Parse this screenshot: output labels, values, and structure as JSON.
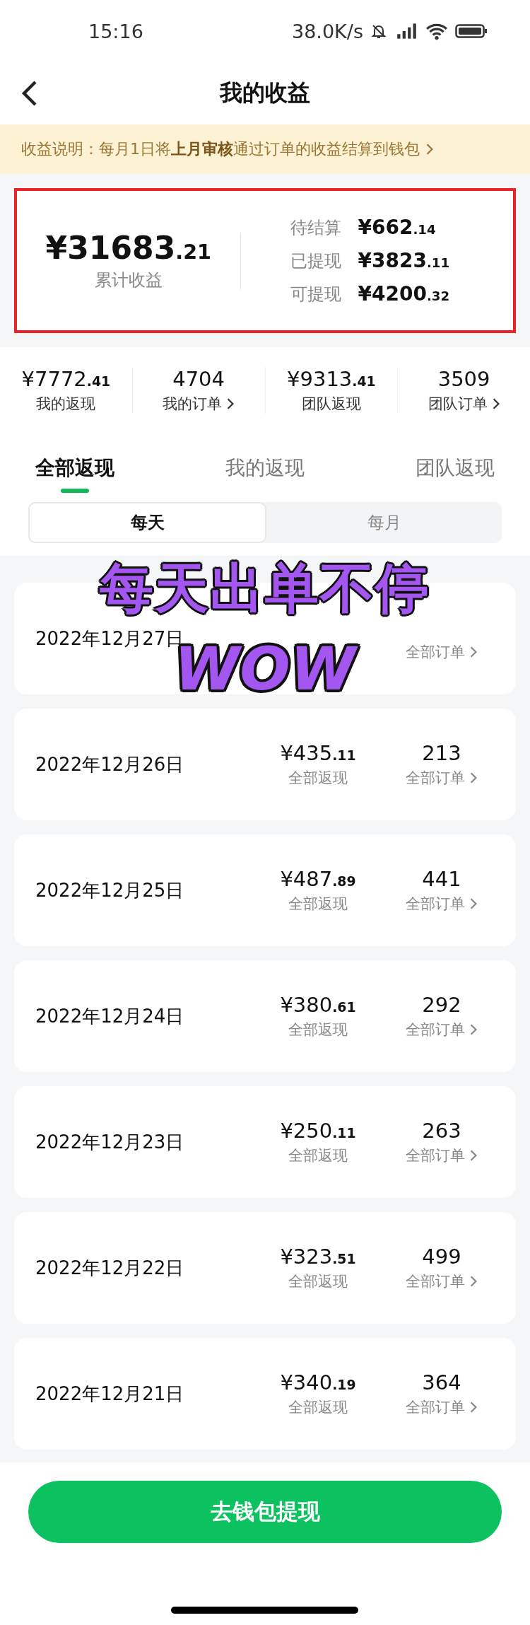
{
  "status_bar": {
    "time": "15:16",
    "speed": "38.0K/s"
  },
  "header": {
    "title": "我的收益"
  },
  "notice": {
    "text": "收益说明：每月1日将**上月审核**通过订单的收益结算到钱包"
  },
  "summary": {
    "total_int": "¥31683",
    "total_dec": ".21",
    "total_label": "累计收益",
    "items": [
      {
        "label": "待结算",
        "int": "¥662",
        "dec": ".14"
      },
      {
        "label": "已提现",
        "int": "¥3823",
        "dec": ".11"
      },
      {
        "label": "可提现",
        "int": "¥4200",
        "dec": ".32"
      }
    ]
  },
  "stats": [
    {
      "int": "¥7772",
      "dec": ".41",
      "label": "我的返现",
      "link": false
    },
    {
      "int": "4704",
      "label": "我的订单",
      "link": true
    },
    {
      "int": "¥9313",
      "dec": ".41",
      "label": "团队返现",
      "link": false
    },
    {
      "int": "3509",
      "label": "团队订单",
      "link": true
    }
  ],
  "tabs": [
    {
      "label": "全部返现",
      "selected": true
    },
    {
      "label": "我的返现",
      "selected": false
    },
    {
      "label": "团队返现",
      "selected": false
    }
  ],
  "periods": [
    {
      "label": "每天",
      "selected": true
    },
    {
      "label": "每月",
      "selected": false
    }
  ],
  "days": [
    {
      "date": "2022年12月27日",
      "orders_label": "全部订单"
    },
    {
      "date": "2022年12月26日",
      "int": "¥435",
      "dec": ".11",
      "amount_label": "全部返现",
      "count": "213",
      "orders_label": "全部订单"
    },
    {
      "date": "2022年12月25日",
      "int": "¥487",
      "dec": ".89",
      "amount_label": "全部返现",
      "count": "441",
      "orders_label": "全部订单"
    },
    {
      "date": "2022年12月24日",
      "int": "¥380",
      "dec": ".61",
      "amount_label": "全部返现",
      "count": "292",
      "orders_label": "全部订单"
    },
    {
      "date": "2022年12月23日",
      "int": "¥250",
      "dec": ".11",
      "amount_label": "全部返现",
      "count": "263",
      "orders_label": "全部订单"
    },
    {
      "date": "2022年12月22日",
      "int": "¥323",
      "dec": ".51",
      "amount_label": "全部返现",
      "count": "499",
      "orders_label": "全部订单"
    },
    {
      "date": "2022年12月21日",
      "int": "¥340",
      "dec": ".19",
      "amount_label": "全部返现",
      "count": "364",
      "orders_label": "全部订单"
    }
  ],
  "overlay": {
    "line1": "每天出单不停",
    "line2": "WOW"
  },
  "button": {
    "label": "去钱包提现"
  }
}
